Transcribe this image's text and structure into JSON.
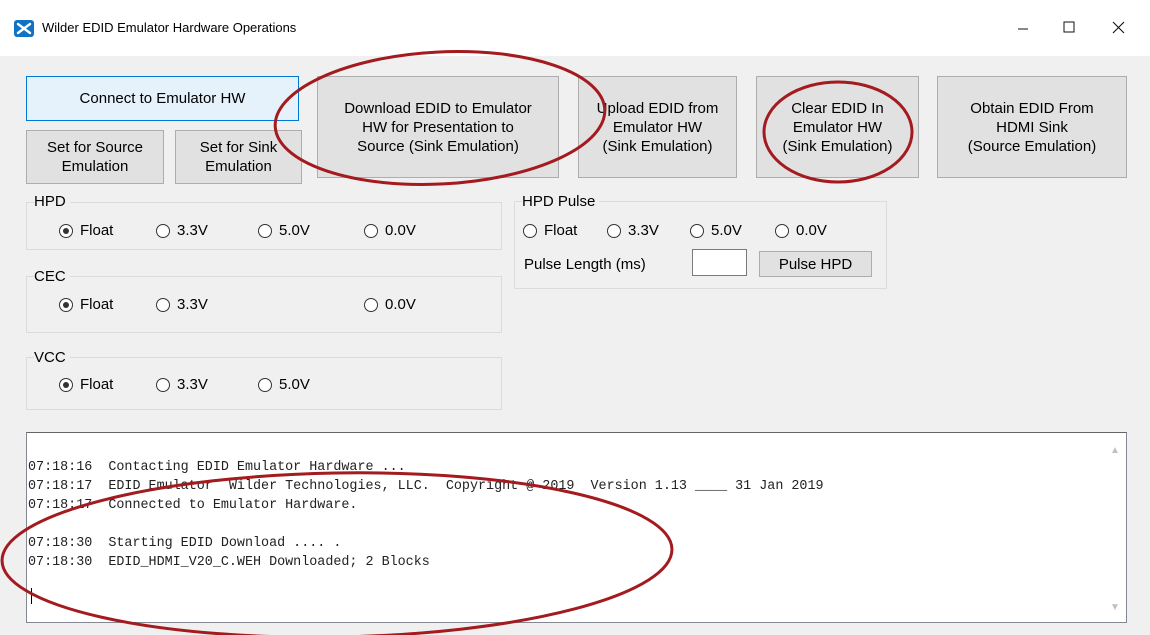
{
  "window": {
    "title": "Wilder EDID Emulator  Hardware Operations",
    "controls": {
      "minimize": "—",
      "maximize": "☐",
      "close": "✕"
    }
  },
  "toolbar": {
    "connect_label": "Connect to Emulator HW",
    "download_label": "Download EDID to Emulator\nHW for Presentation to\nSource (Sink Emulation)",
    "upload_label": "Upload EDID from\nEmulator HW\n(Sink Emulation)",
    "clear_label": "Clear EDID In\nEmulator HW\n(Sink Emulation)",
    "obtain_label": "Obtain EDID From\nHDMI Sink\n(Source Emulation)",
    "source_emulation_label": "Set for Source\nEmulation",
    "sink_emulation_label": "Set for Sink\nEmulation"
  },
  "hpd": {
    "label": "HPD",
    "options": [
      "Float",
      "3.3V",
      "5.0V",
      "0.0V"
    ],
    "selected": "Float"
  },
  "cec": {
    "label": "CEC",
    "options": [
      "Float",
      "3.3V",
      "0.0V"
    ],
    "selected": "Float"
  },
  "vcc": {
    "label": "VCC",
    "options": [
      "Float",
      "3.3V",
      "5.0V"
    ],
    "selected": "Float"
  },
  "hpd_pulse": {
    "label": "HPD Pulse",
    "options": [
      "Float",
      "3.3V",
      "5.0V",
      "0.0V"
    ],
    "selected": "",
    "length_label": "Pulse Length (ms)",
    "length_value": "",
    "pulse_button_label": "Pulse HPD"
  },
  "log": {
    "lines": [
      "07:18:16  Contacting EDID Emulator Hardware ...",
      "07:18:17  EDID Emulator  Wilder Technologies, LLC.  Copyright @ 2019  Version 1.13 ____ 31 Jan 2019",
      "07:18:17  Connected to Emulator Hardware.",
      "",
      "07:18:30  Starting EDID Download .... .",
      "07:18:30  EDID_HDMI_V20_C.WEH Downloaded; 2 Blocks"
    ]
  },
  "colors": {
    "annotation": "#a31a1f",
    "primary_border": "#0078d7",
    "icon": "#1273c4"
  }
}
